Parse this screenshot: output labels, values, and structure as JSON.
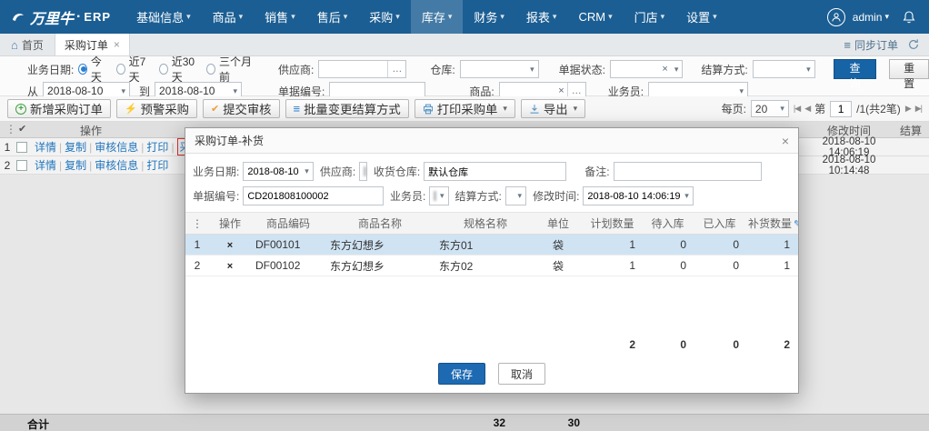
{
  "icons": {
    "home": "⌂",
    "close": "×",
    "caret": "▾",
    "list": "≡",
    "grip": "⋮",
    "check": "✔",
    "ellipsis": "…",
    "plus": "+",
    "bolt": "⚡",
    "pencil": "✎",
    "pager_first": "|◀",
    "pager_prev": "◀",
    "pager_next": "▶",
    "pager_last": "▶|"
  },
  "topbar": {
    "logo_cn": "万里牛",
    "logo_dot": "·",
    "logo_en": "ERP",
    "menus": [
      {
        "label": "基础信息"
      },
      {
        "label": "商品"
      },
      {
        "label": "销售"
      },
      {
        "label": "售后"
      },
      {
        "label": "采购"
      },
      {
        "label": "库存"
      },
      {
        "label": "财务"
      },
      {
        "label": "报表"
      },
      {
        "label": "CRM"
      },
      {
        "label": "门店"
      },
      {
        "label": "设置"
      }
    ],
    "user": "admin"
  },
  "tabbar": {
    "home": "首页",
    "tab": "采购订单",
    "sync": "同步订单"
  },
  "filters": {
    "date_label": "业务日期:",
    "date_options": [
      "今天",
      "近7天",
      "近30天",
      "三个月前"
    ],
    "supplier_label": "供应商:",
    "warehouse_label": "仓库:",
    "status_label": "单据状态:",
    "settle_label": "结算方式:",
    "search_btn": "查询",
    "reset_btn": "重置",
    "from_label": "从",
    "from_value": "2018-08-10",
    "to_label": "到",
    "to_value": "2018-08-10",
    "orderno_label": "单据编号:",
    "product_label": "商品:",
    "salesman_label": "业务员:"
  },
  "toolbar": {
    "buttons": [
      "新增采购订单",
      "预警采购",
      "提交审核",
      "批量变更结算方式",
      "打印采购单",
      "导出"
    ],
    "per_page_label": "每页:",
    "per_page_value": "20",
    "page_prefix": "第",
    "page_value": "1",
    "page_suffix": "/1(共2笔)"
  },
  "grid": {
    "op_header": "操作",
    "modified_header": "修改时间",
    "settle_header": "结算",
    "rows": [
      {
        "num": "1",
        "links": [
          "详情",
          "复制",
          "审核信息",
          "打印",
          "采购补货"
        ],
        "modified": "2018-08-10 14:06:19"
      },
      {
        "num": "2",
        "links": [
          "详情",
          "复制",
          "审核信息",
          "打印"
        ],
        "modified": "2018-08-10 10:14:48"
      }
    ],
    "footer_label": "合计",
    "footer_total1": "32",
    "footer_total2": "30"
  },
  "modal": {
    "title": "采购订单-补货",
    "fields": {
      "date": {
        "label": "业务日期:",
        "value": "2018-08-10"
      },
      "supplier": {
        "label": "供应商:",
        "value": ""
      },
      "warehouse": {
        "label": "收货仓库:",
        "value": "默认仓库"
      },
      "remark": {
        "label": "备注:",
        "value": ""
      },
      "orderno": {
        "label": "单据编号:",
        "value": "CD201808100002"
      },
      "salesman": {
        "label": "业务员:",
        "value": ""
      },
      "settle": {
        "label": "结算方式:",
        "value": ""
      },
      "modified": {
        "label": "修改时间:",
        "value": "2018-08-10 14:06:19"
      }
    },
    "table": {
      "headers": [
        "操作",
        "商品编码",
        "商品名称",
        "规格名称",
        "单位",
        "计划数量",
        "待入库",
        "已入库",
        "补货数量"
      ],
      "rows": [
        {
          "num": "1",
          "code": "DF00101",
          "name": "东方幻想乡",
          "spec": "东方01",
          "unit": "袋",
          "plan": "1",
          "pending": "0",
          "received": "0",
          "replenish": "1"
        },
        {
          "num": "2",
          "code": "DF00102",
          "name": "东方幻想乡",
          "spec": "东方02",
          "unit": "袋",
          "plan": "1",
          "pending": "0",
          "received": "0",
          "replenish": "1"
        }
      ],
      "totals": {
        "plan": "2",
        "pending": "0",
        "received": "0",
        "replenish": "2"
      }
    },
    "save_btn": "保存",
    "cancel_btn": "取消"
  }
}
